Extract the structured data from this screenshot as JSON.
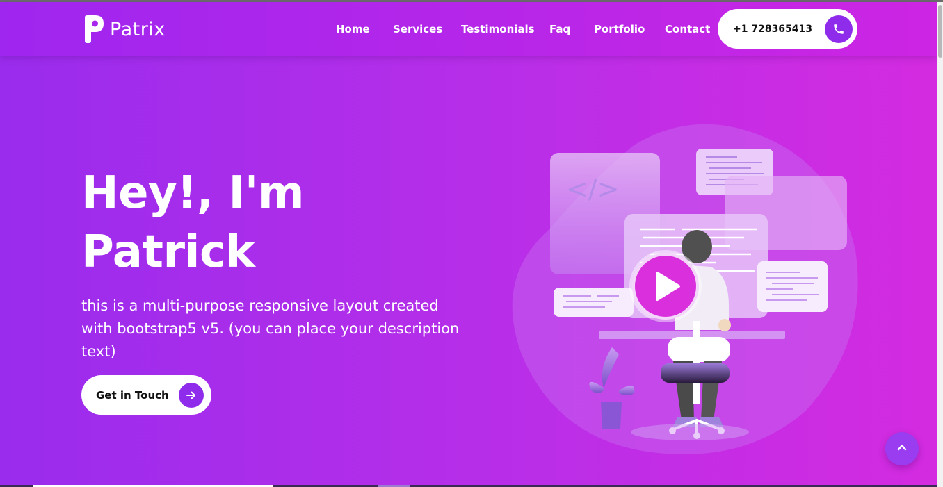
{
  "brand": {
    "name": "Patrix"
  },
  "nav": {
    "items": [
      {
        "label": "Home"
      },
      {
        "label": "Services"
      },
      {
        "label": "Testimonials"
      },
      {
        "label": "Faq"
      },
      {
        "label": "Portfolio"
      },
      {
        "label": "Contact"
      }
    ],
    "phone": "+1 728365413"
  },
  "hero": {
    "title_line1": "Hey!, I'm",
    "title_line2": "Patrick",
    "description": "this is a multi-purpose responsive layout created with bootstrap5 v5. (you can place your description text)",
    "cta_label": "Get in Touch"
  },
  "illustration": {
    "code_tag": "</>"
  },
  "icons": {
    "phone": "phone-icon",
    "cta_arrow": "arrow-right-icon",
    "scroll_top": "chevron-up-icon",
    "play": "play-icon"
  },
  "colors": {
    "gradient_start": "#9a2ced",
    "gradient_end": "#d42be0",
    "accent": "#8f2bea",
    "button_bg": "#ffffff"
  }
}
